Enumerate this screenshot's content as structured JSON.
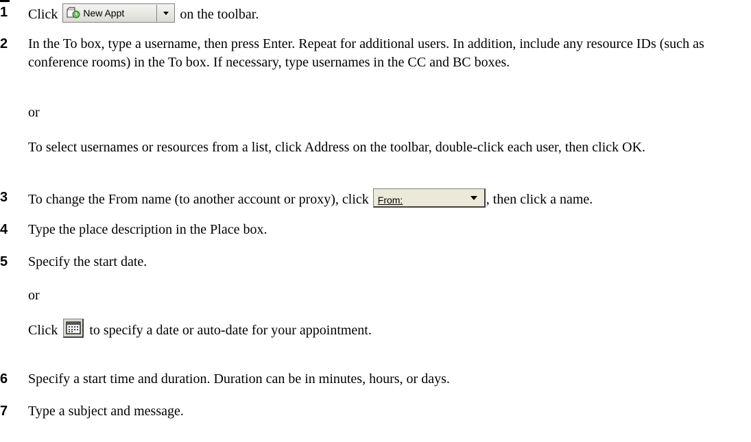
{
  "steps": [
    {
      "num": "1",
      "pre": "Click ",
      "post": " on the toolbar.",
      "button": {
        "label": "New Appt",
        "icon": "new-appointment-icon"
      }
    },
    {
      "num": "2",
      "text": "In the To box, type a username, then press Enter. Repeat for additional users. In addition, include any resource IDs (such as conference rooms) in the To box. If necessary, type usernames in the CC and BC boxes.",
      "or": "or",
      "alt": "To select usernames or resources from a list, click Address on the toolbar, double-click each user, then click OK."
    },
    {
      "num": "3",
      "pre": "To change the From name (to another account or proxy), click ",
      "post": ", then click a name.",
      "dropdown": {
        "label": "From:"
      }
    },
    {
      "num": "4",
      "text": "Type the place description in the Place box."
    },
    {
      "num": "5",
      "text": "Specify the start date.",
      "or": "or",
      "alt_pre": "Click ",
      "alt_post": " to specify a date or auto-date for your appointment.",
      "icon": "calendar-icon"
    },
    {
      "num": "6",
      "text": "Specify a start time and duration. Duration can be in minutes, hours, or days."
    },
    {
      "num": "7",
      "text": "Type a subject and message."
    }
  ]
}
